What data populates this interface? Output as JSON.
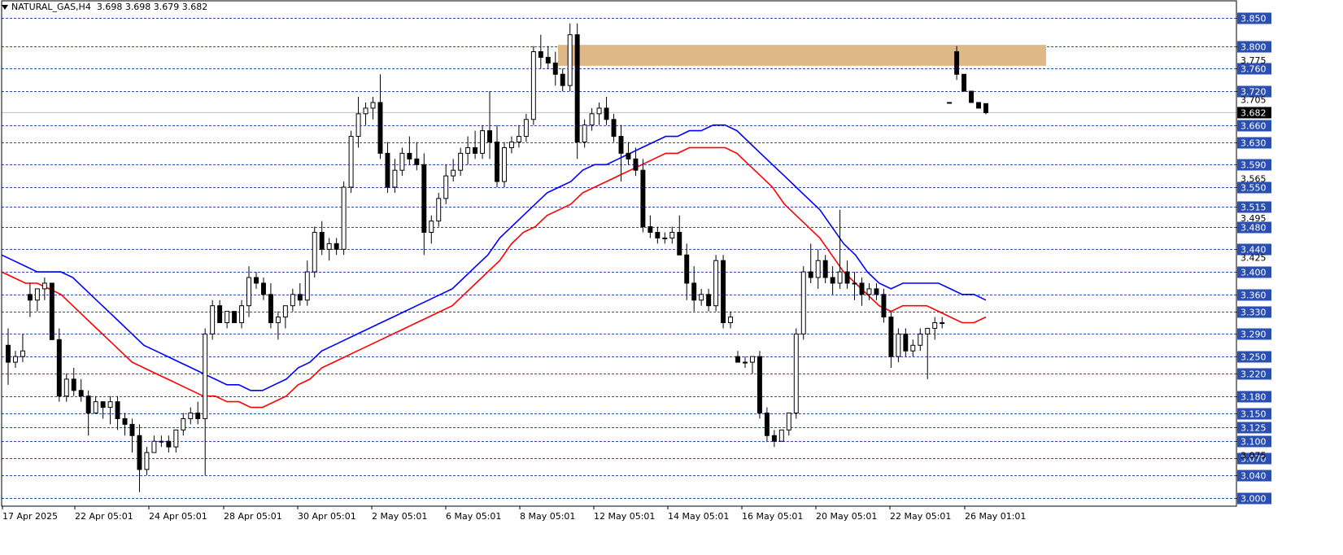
{
  "header": {
    "symbol": "NATURAL_GAS,H4",
    "ohlc": "3.698 3.698 3.679 3.682"
  },
  "colors": {
    "background": "#ffffff",
    "grid": "#2a4fb0",
    "bull_body": "#ffffff",
    "bear_body": "#000000",
    "candle_outline": "#000000",
    "ma_fast": "#0000ff",
    "ma_slow": "#ff0000",
    "zone": "#deb887",
    "price_tag_bg": "#000000",
    "price_tag_fg": "#ffffff"
  },
  "chart_data": {
    "type": "candlestick",
    "ylim": [
      2.985,
      3.87
    ],
    "grid": true,
    "y_tick_labels": [
      "3.850",
      "3.800",
      "3.760",
      "3.720",
      "3.660",
      "3.630",
      "3.590",
      "3.550",
      "3.515",
      "3.480",
      "3.440",
      "3.400",
      "3.360",
      "3.330",
      "3.290",
      "3.250",
      "3.220",
      "3.180",
      "3.150",
      "3.125",
      "3.100",
      "3.070",
      "3.040",
      "3.000"
    ],
    "y_extra_labels": [
      "3.775",
      "3.705",
      "3.565",
      "3.495",
      "3.425",
      "3.075"
    ],
    "current_price": "3.682",
    "x_tick_labels": [
      "17 Apr 2025",
      "22 Apr 05:01",
      "24 Apr 05:01",
      "28 Apr 05:01",
      "30 Apr 05:01",
      "2 May 05:01",
      "6 May 05:01",
      "8 May 05:01",
      "12 May 05:01",
      "14 May 05:01",
      "16 May 05:01",
      "20 May 05:01",
      "22 May 05:01",
      "26 May 01:01"
    ],
    "resistance_zone": [
      3.765,
      3.802
    ],
    "candles": [
      [
        3.27,
        3.3,
        3.2,
        3.24
      ],
      [
        3.24,
        3.26,
        3.23,
        3.25
      ],
      [
        3.25,
        3.29,
        3.24,
        3.26
      ],
      [
        3.36,
        3.38,
        3.32,
        3.35
      ],
      [
        3.35,
        3.37,
        3.33,
        3.37
      ],
      [
        3.37,
        3.39,
        3.35,
        3.38
      ],
      [
        3.38,
        3.38,
        3.28,
        3.28
      ],
      [
        3.28,
        3.3,
        3.17,
        3.18
      ],
      [
        3.18,
        3.22,
        3.17,
        3.21
      ],
      [
        3.21,
        3.23,
        3.18,
        3.19
      ],
      [
        3.19,
        3.21,
        3.17,
        3.18
      ],
      [
        3.18,
        3.19,
        3.11,
        3.15
      ],
      [
        3.15,
        3.18,
        3.15,
        3.17
      ],
      [
        3.17,
        3.17,
        3.14,
        3.16
      ],
      [
        3.16,
        3.18,
        3.13,
        3.17
      ],
      [
        3.17,
        3.18,
        3.12,
        3.14
      ],
      [
        3.14,
        3.15,
        3.11,
        3.13
      ],
      [
        3.13,
        3.14,
        3.08,
        3.11
      ],
      [
        3.11,
        3.13,
        3.01,
        3.05
      ],
      [
        3.05,
        3.09,
        3.04,
        3.08
      ],
      [
        3.08,
        3.11,
        3.08,
        3.1
      ],
      [
        3.1,
        3.11,
        3.09,
        3.1
      ],
      [
        3.1,
        3.11,
        3.08,
        3.09
      ],
      [
        3.09,
        3.12,
        3.08,
        3.12
      ],
      [
        3.12,
        3.15,
        3.11,
        3.14
      ],
      [
        3.14,
        3.16,
        3.13,
        3.15
      ],
      [
        3.15,
        3.17,
        3.13,
        3.14
      ],
      [
        3.14,
        3.3,
        3.04,
        3.29
      ],
      [
        3.29,
        3.35,
        3.28,
        3.34
      ],
      [
        3.34,
        3.35,
        3.31,
        3.31
      ],
      [
        3.31,
        3.33,
        3.3,
        3.33
      ],
      [
        3.33,
        3.33,
        3.31,
        3.31
      ],
      [
        3.31,
        3.35,
        3.3,
        3.34
      ],
      [
        3.34,
        3.41,
        3.32,
        3.39
      ],
      [
        3.39,
        3.4,
        3.37,
        3.38
      ],
      [
        3.38,
        3.39,
        3.35,
        3.36
      ],
      [
        3.36,
        3.38,
        3.3,
        3.31
      ],
      [
        3.31,
        3.33,
        3.28,
        3.32
      ],
      [
        3.32,
        3.34,
        3.3,
        3.34
      ],
      [
        3.34,
        3.37,
        3.33,
        3.36
      ],
      [
        3.36,
        3.38,
        3.34,
        3.35
      ],
      [
        3.35,
        3.42,
        3.34,
        3.4
      ],
      [
        3.4,
        3.48,
        3.39,
        3.47
      ],
      [
        3.47,
        3.49,
        3.43,
        3.44
      ],
      [
        3.44,
        3.46,
        3.42,
        3.45
      ],
      [
        3.45,
        3.46,
        3.43,
        3.44
      ],
      [
        3.44,
        3.56,
        3.43,
        3.55
      ],
      [
        3.55,
        3.65,
        3.54,
        3.64
      ],
      [
        3.64,
        3.71,
        3.62,
        3.68
      ],
      [
        3.68,
        3.7,
        3.66,
        3.69
      ],
      [
        3.69,
        3.71,
        3.67,
        3.7
      ],
      [
        3.7,
        3.75,
        3.6,
        3.61
      ],
      [
        3.61,
        3.63,
        3.54,
        3.55
      ],
      [
        3.55,
        3.6,
        3.54,
        3.58
      ],
      [
        3.58,
        3.62,
        3.57,
        3.61
      ],
      [
        3.61,
        3.64,
        3.59,
        3.6
      ],
      [
        3.6,
        3.63,
        3.58,
        3.59
      ],
      [
        3.59,
        3.61,
        3.43,
        3.47
      ],
      [
        3.47,
        3.5,
        3.45,
        3.49
      ],
      [
        3.49,
        3.54,
        3.48,
        3.53
      ],
      [
        3.53,
        3.59,
        3.52,
        3.57
      ],
      [
        3.57,
        3.6,
        3.56,
        3.58
      ],
      [
        3.58,
        3.62,
        3.57,
        3.61
      ],
      [
        3.61,
        3.64,
        3.59,
        3.62
      ],
      [
        3.62,
        3.65,
        3.6,
        3.61
      ],
      [
        3.61,
        3.66,
        3.6,
        3.65
      ],
      [
        3.65,
        3.72,
        3.6,
        3.63
      ],
      [
        3.63,
        3.66,
        3.55,
        3.56
      ],
      [
        3.56,
        3.63,
        3.55,
        3.62
      ],
      [
        3.62,
        3.64,
        3.61,
        3.63
      ],
      [
        3.63,
        3.66,
        3.62,
        3.64
      ],
      [
        3.64,
        3.68,
        3.63,
        3.67
      ],
      [
        3.67,
        3.8,
        3.66,
        3.79
      ],
      [
        3.79,
        3.82,
        3.76,
        3.78
      ],
      [
        3.78,
        3.8,
        3.76,
        3.77
      ],
      [
        3.77,
        3.79,
        3.73,
        3.75
      ],
      [
        3.75,
        3.76,
        3.72,
        3.73
      ],
      [
        3.73,
        3.84,
        3.72,
        3.82
      ],
      [
        3.82,
        3.84,
        3.6,
        3.63
      ],
      [
        3.63,
        3.67,
        3.62,
        3.66
      ],
      [
        3.66,
        3.69,
        3.65,
        3.68
      ],
      [
        3.68,
        3.7,
        3.66,
        3.69
      ],
      [
        3.69,
        3.71,
        3.66,
        3.67
      ],
      [
        3.67,
        3.68,
        3.63,
        3.64
      ],
      [
        3.64,
        3.66,
        3.56,
        3.61
      ],
      [
        3.61,
        3.63,
        3.59,
        3.6
      ],
      [
        3.6,
        3.62,
        3.57,
        3.58
      ],
      [
        3.58,
        3.6,
        3.47,
        3.48
      ],
      [
        3.48,
        3.5,
        3.46,
        3.47
      ],
      [
        3.47,
        3.48,
        3.45,
        3.46
      ],
      [
        3.46,
        3.47,
        3.45,
        3.46
      ],
      [
        3.46,
        3.48,
        3.45,
        3.47
      ],
      [
        3.47,
        3.5,
        3.44,
        3.43
      ],
      [
        3.43,
        3.45,
        3.35,
        3.38
      ],
      [
        3.38,
        3.41,
        3.33,
        3.35
      ],
      [
        3.35,
        3.37,
        3.34,
        3.36
      ],
      [
        3.36,
        3.37,
        3.33,
        3.34
      ],
      [
        3.34,
        3.43,
        3.33,
        3.42
      ],
      [
        3.42,
        3.43,
        3.3,
        3.31
      ],
      [
        3.31,
        3.33,
        3.3,
        3.32
      ],
      [
        3.25,
        3.26,
        3.24,
        3.24
      ],
      [
        3.24,
        3.25,
        3.23,
        3.24
      ],
      [
        3.24,
        3.25,
        3.22,
        3.25
      ],
      [
        3.25,
        3.26,
        3.14,
        3.15
      ],
      [
        3.15,
        3.16,
        3.1,
        3.11
      ],
      [
        3.11,
        3.12,
        3.09,
        3.1
      ],
      [
        3.1,
        3.12,
        3.1,
        3.12
      ],
      [
        3.12,
        3.15,
        3.11,
        3.15
      ],
      [
        3.15,
        3.3,
        3.14,
        3.29
      ],
      [
        3.29,
        3.41,
        3.28,
        3.4
      ],
      [
        3.4,
        3.45,
        3.38,
        3.39
      ],
      [
        3.39,
        3.44,
        3.37,
        3.42
      ],
      [
        3.42,
        3.43,
        3.38,
        3.39
      ],
      [
        3.39,
        3.41,
        3.36,
        3.38
      ],
      [
        3.38,
        3.51,
        3.37,
        3.4
      ],
      [
        3.4,
        3.42,
        3.37,
        3.38
      ],
      [
        3.38,
        3.4,
        3.35,
        3.38
      ],
      [
        3.38,
        3.39,
        3.34,
        3.36
      ],
      [
        3.36,
        3.38,
        3.35,
        3.37
      ],
      [
        3.37,
        3.38,
        3.35,
        3.36
      ],
      [
        3.36,
        3.37,
        3.31,
        3.32
      ],
      [
        3.32,
        3.33,
        3.23,
        3.25
      ],
      [
        3.25,
        3.3,
        3.24,
        3.29
      ],
      [
        3.29,
        3.3,
        3.25,
        3.26
      ],
      [
        3.26,
        3.28,
        3.25,
        3.27
      ],
      [
        3.27,
        3.3,
        3.26,
        3.29
      ],
      [
        3.29,
        3.3,
        3.21,
        3.3
      ],
      [
        3.3,
        3.32,
        3.28,
        3.31
      ],
      [
        3.31,
        3.32,
        3.3,
        3.31
      ],
      [
        3.7,
        3.7,
        3.7,
        3.7
      ],
      [
        3.79,
        3.8,
        3.74,
        3.75
      ],
      [
        3.75,
        3.75,
        3.72,
        3.72
      ],
      [
        3.72,
        3.72,
        3.7,
        3.7
      ],
      [
        3.7,
        3.7,
        3.69,
        3.69
      ],
      [
        3.698,
        3.698,
        3.679,
        3.682
      ]
    ],
    "ma_fast": [
      3.43,
      3.42,
      3.41,
      3.4,
      3.4,
      3.4,
      3.39,
      3.37,
      3.35,
      3.33,
      3.31,
      3.29,
      3.27,
      3.26,
      3.25,
      3.24,
      3.23,
      3.22,
      3.21,
      3.2,
      3.2,
      3.19,
      3.19,
      3.2,
      3.21,
      3.23,
      3.24,
      3.26,
      3.27,
      3.28,
      3.29,
      3.3,
      3.31,
      3.32,
      3.33,
      3.34,
      3.35,
      3.36,
      3.37,
      3.39,
      3.41,
      3.43,
      3.46,
      3.48,
      3.5,
      3.52,
      3.54,
      3.55,
      3.56,
      3.58,
      3.59,
      3.59,
      3.6,
      3.61,
      3.62,
      3.63,
      3.64,
      3.64,
      3.65,
      3.65,
      3.66,
      3.66,
      3.65,
      3.63,
      3.61,
      3.59,
      3.57,
      3.55,
      3.53,
      3.51,
      3.48,
      3.45,
      3.43,
      3.4,
      3.38,
      3.37,
      3.38,
      3.38,
      3.38,
      3.38,
      3.37,
      3.36,
      3.36,
      3.35
    ],
    "ma_slow": [
      3.4,
      3.39,
      3.38,
      3.38,
      3.37,
      3.36,
      3.34,
      3.32,
      3.3,
      3.28,
      3.26,
      3.24,
      3.23,
      3.22,
      3.21,
      3.2,
      3.19,
      3.18,
      3.18,
      3.17,
      3.17,
      3.16,
      3.16,
      3.17,
      3.18,
      3.2,
      3.21,
      3.23,
      3.24,
      3.25,
      3.26,
      3.27,
      3.28,
      3.29,
      3.3,
      3.31,
      3.32,
      3.33,
      3.34,
      3.36,
      3.38,
      3.4,
      3.42,
      3.45,
      3.47,
      3.48,
      3.5,
      3.51,
      3.52,
      3.54,
      3.55,
      3.56,
      3.57,
      3.58,
      3.59,
      3.6,
      3.61,
      3.61,
      3.62,
      3.62,
      3.62,
      3.62,
      3.61,
      3.59,
      3.57,
      3.55,
      3.52,
      3.5,
      3.48,
      3.46,
      3.43,
      3.4,
      3.38,
      3.36,
      3.34,
      3.33,
      3.34,
      3.34,
      3.34,
      3.33,
      3.32,
      3.31,
      3.31,
      3.32
    ]
  }
}
